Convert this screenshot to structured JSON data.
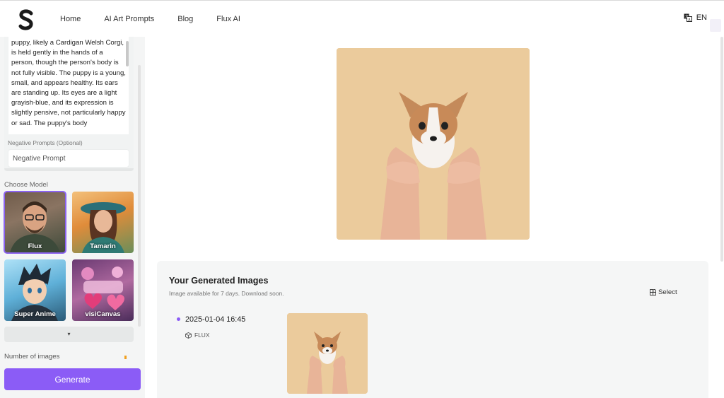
{
  "header": {
    "logo_letter": "S",
    "nav": [
      "Home",
      "AI Art Prompts",
      "Blog",
      "Flux AI"
    ],
    "language": "EN"
  },
  "sidebar": {
    "prompt_text": "puppy, likely a Cardigan Welsh Corgi, is held gently in the hands of a person, though the person's body is not fully visible. The puppy is a young,  small, and appears healthy.  Its ears are standing up. Its eyes are a light grayish-blue, and its expression is slightly pensive, not particularly happy or sad. The puppy's body",
    "negative_label": "Negative Prompts  (Optional)",
    "negative_placeholder": "Negative Prompt",
    "choose_model_label": "Choose Model",
    "models": [
      {
        "name": "Flux",
        "selected": true
      },
      {
        "name": "Tamarin",
        "selected": false
      },
      {
        "name": "Super Anime",
        "selected": false
      },
      {
        "name": "visiCanvas",
        "selected": false
      }
    ],
    "more_icon": "▾",
    "number_label": "Number of images",
    "generate_label": "Generate"
  },
  "results": {
    "title": "Your Generated Images",
    "subtitle": "Image available for 7 days. Download soon.",
    "select_label": "Select",
    "entries": [
      {
        "date": "2025-01-04 16:45",
        "model": "FLUX"
      }
    ]
  },
  "colors": {
    "accent": "#8b5cf6",
    "image_bg": "#e9c898"
  }
}
